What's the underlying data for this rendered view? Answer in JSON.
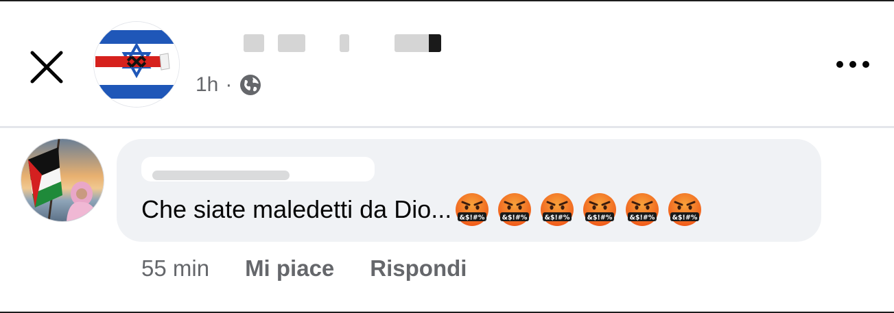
{
  "header": {
    "close_icon": "close-icon",
    "page_name": "",
    "post_time": "1h",
    "separator": "·",
    "privacy_icon": "globe-icon",
    "more_icon": "more-horizontal-icon"
  },
  "comment": {
    "author_name": "",
    "text": "Che siate maledetti da Dio...",
    "emojis": [
      "face-with-symbols-on-mouth",
      "face-with-symbols-on-mouth",
      "face-with-symbols-on-mouth",
      "face-with-symbols-on-mouth",
      "face-with-symbols-on-mouth",
      "face-with-symbols-on-mouth"
    ],
    "emoji_symbols": "&$!#%",
    "time": "55 min",
    "like_label": "Mi piace",
    "reply_label": "Rispondi"
  },
  "colors": {
    "secondary_text": "#65676b",
    "bubble_bg": "#f0f2f5",
    "divider": "#e4e6eb",
    "israel_blue": "#1f57b8",
    "emoji_orange": "#f05a1a"
  }
}
